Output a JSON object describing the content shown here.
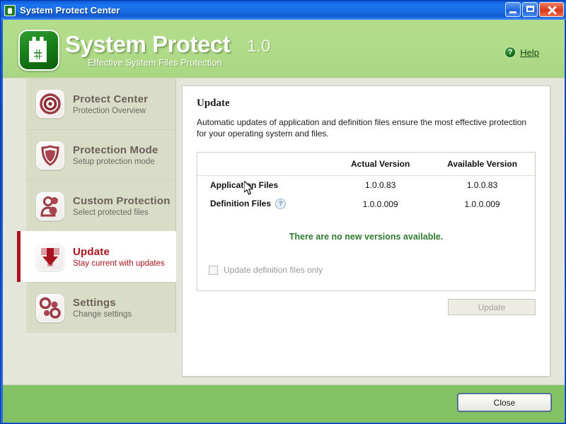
{
  "window": {
    "title": "System Protect Center",
    "icon": "castle-icon",
    "controls": {
      "minimize": "minimize-button",
      "maximize": "maximize-button",
      "close": "close-button"
    }
  },
  "brand": {
    "name": "System Protect",
    "version": "1.0",
    "tagline": "Effective System Files Protection",
    "help_label": "Help",
    "help_icon": "question-mark-icon",
    "header_color": "#b3dd8c",
    "logo_color": "#157a15"
  },
  "sidebar": {
    "items": [
      {
        "title": "Protect Center",
        "sub": "Protection Overview",
        "icon": "target-icon",
        "selected": false
      },
      {
        "title": "Protection Mode",
        "sub": "Setup protection mode",
        "icon": "shield-icon",
        "selected": false
      },
      {
        "title": "Custom Protection",
        "sub": "Select protected files",
        "icon": "person-lock-icon",
        "selected": false
      },
      {
        "title": "Update",
        "sub": "Stay current with updates",
        "icon": "download-arrow-icon",
        "selected": true
      },
      {
        "title": "Settings",
        "sub": "Change settings",
        "icon": "gears-icon",
        "selected": false
      }
    ],
    "accent_color": "#a8141e"
  },
  "content": {
    "title": "Update",
    "description": "Automatic updates of application and definition files ensure the most effective protection for your operating system and files.",
    "table": {
      "headers": [
        "",
        "Actual Version",
        "Available Version"
      ],
      "rows": [
        {
          "label": "Application Files",
          "actual": "1.0.0.83",
          "available": "1.0.0.83",
          "has_help": false
        },
        {
          "label": "Definition Files",
          "actual": "1.0.0.009",
          "available": "1.0.0.009",
          "has_help": true
        }
      ]
    },
    "status_message": "There are no new versions available.",
    "status_color": "#2f7a2f",
    "checkbox": {
      "label": "Update definition files only",
      "checked": false,
      "enabled": false
    },
    "update_button": {
      "label": "Update",
      "enabled": false
    }
  },
  "footer": {
    "close_label": "Close"
  }
}
